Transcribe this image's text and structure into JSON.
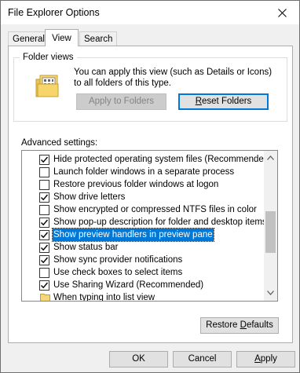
{
  "window": {
    "title": "File Explorer Options",
    "close_glyph": "✕"
  },
  "tabs": [
    {
      "label": "General",
      "active": false
    },
    {
      "label": "View",
      "active": true
    },
    {
      "label": "Search",
      "active": false
    }
  ],
  "folder_views": {
    "legend": "Folder views",
    "description": "You can apply this view (such as Details or Icons) to all folders of this type.",
    "apply_label": "Apply to Folders",
    "reset_label_mnemonic": "R",
    "reset_label_rest": "eset Folders"
  },
  "advanced": {
    "label": "Advanced settings:",
    "items": [
      {
        "label": "Hide protected operating system files (Recommended)",
        "checked": true,
        "type": "checkbox"
      },
      {
        "label": "Launch folder windows in a separate process",
        "checked": false,
        "type": "checkbox"
      },
      {
        "label": "Restore previous folder windows at logon",
        "checked": false,
        "type": "checkbox"
      },
      {
        "label": "Show drive letters",
        "checked": true,
        "type": "checkbox"
      },
      {
        "label": "Show encrypted or compressed NTFS files in color",
        "checked": false,
        "type": "checkbox"
      },
      {
        "label": "Show pop-up description for folder and desktop items",
        "checked": true,
        "type": "checkbox"
      },
      {
        "label": "Show preview handlers in preview pane",
        "checked": true,
        "type": "checkbox",
        "selected": true
      },
      {
        "label": "Show status bar",
        "checked": true,
        "type": "checkbox"
      },
      {
        "label": "Show sync provider notifications",
        "checked": true,
        "type": "checkbox"
      },
      {
        "label": "Use check boxes to select items",
        "checked": false,
        "type": "checkbox"
      },
      {
        "label": "Use Sharing Wizard (Recommended)",
        "checked": true,
        "type": "checkbox"
      },
      {
        "label": "When typing into list view",
        "type": "folder"
      }
    ]
  },
  "restore_defaults": {
    "pre": "Restore ",
    "mnemonic": "D",
    "post": "efaults"
  },
  "footer": {
    "ok": "OK",
    "cancel": "Cancel",
    "apply_mnemonic": "A",
    "apply_rest": "pply"
  }
}
